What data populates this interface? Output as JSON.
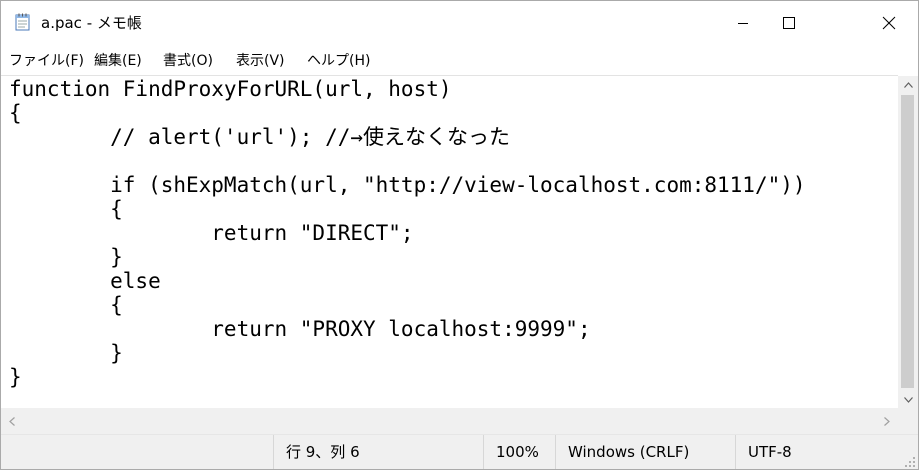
{
  "window": {
    "title": "a.pac - メモ帳",
    "app_icon": "notepad-icon",
    "controls": {
      "minimize_icon": "minimize-icon",
      "maximize_icon": "maximize-icon",
      "close_icon": "close-icon"
    }
  },
  "menu": [
    {
      "label": "ファイル(F)"
    },
    {
      "label": "編集(E)"
    },
    {
      "label": "書式(O)"
    },
    {
      "label": "表示(V)"
    },
    {
      "label": "ヘルプ(H)"
    }
  ],
  "editor": {
    "lines": [
      "function FindProxyForURL(url, host)",
      "{",
      "        // alert('url'); //→使えなくなった",
      "",
      "        if (shExpMatch(url, \"http://view-localhost.com:8111/\"))",
      "        {",
      "                return \"DIRECT\";",
      "        }",
      "        else",
      "        {",
      "                return \"PROXY localhost:9999\";",
      "        }",
      "}"
    ]
  },
  "scrollbars": {
    "vertical": {
      "up_icon": "arrow-up-icon",
      "down_icon": "arrow-down-icon"
    },
    "horizontal": {
      "left_icon": "arrow-left-icon",
      "right_icon": "arrow-right-icon"
    }
  },
  "status": {
    "position": "行 9、列 6",
    "zoom": "100%",
    "line_ending": "Windows (CRLF)",
    "encoding": "UTF-8"
  },
  "colors": {
    "chrome": "#f0f0f0",
    "scroll_thumb": "#cdcdcd",
    "text": "#000000"
  }
}
